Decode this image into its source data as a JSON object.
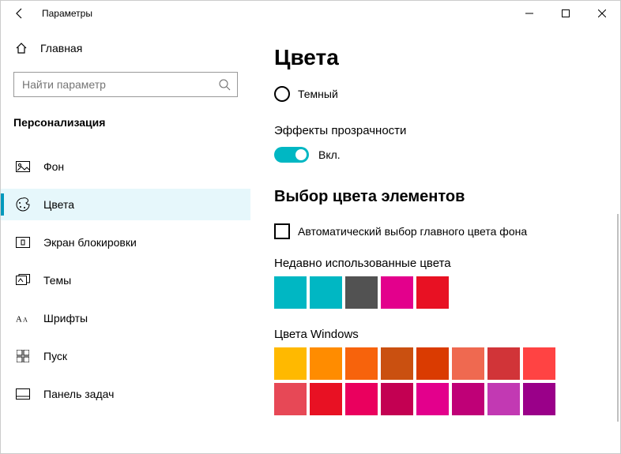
{
  "window": {
    "title": "Параметры"
  },
  "sidebar": {
    "home_label": "Главная",
    "search_placeholder": "Найти параметр",
    "category": "Персонализация",
    "items": [
      {
        "label": "Фон"
      },
      {
        "label": "Цвета"
      },
      {
        "label": "Экран блокировки"
      },
      {
        "label": "Темы"
      },
      {
        "label": "Шрифты"
      },
      {
        "label": "Пуск"
      },
      {
        "label": "Панель задач"
      }
    ]
  },
  "main": {
    "title": "Цвета",
    "dark_option": "Темный",
    "transparency_label": "Эффекты прозрачности",
    "toggle_on": "Вкл.",
    "accent_heading": "Выбор цвета элементов",
    "auto_pick_label": "Автоматический выбор главного цвета фона",
    "recent_label": "Недавно использованные цвета",
    "recent_colors": [
      "#00b7c3",
      "#00b7c3",
      "#525252",
      "#e3008c",
      "#e81123"
    ],
    "windows_label": "Цвета Windows",
    "windows_colors": [
      "#ffb900",
      "#ff8c00",
      "#f7630c",
      "#ca5010",
      "#da3b01",
      "#ef6950",
      "#d13438",
      "#ff4343",
      "#e74856",
      "#e81123",
      "#ea005e",
      "#c30052",
      "#e3008c",
      "#bf0077",
      "#c239b3",
      "#9a0089"
    ]
  }
}
